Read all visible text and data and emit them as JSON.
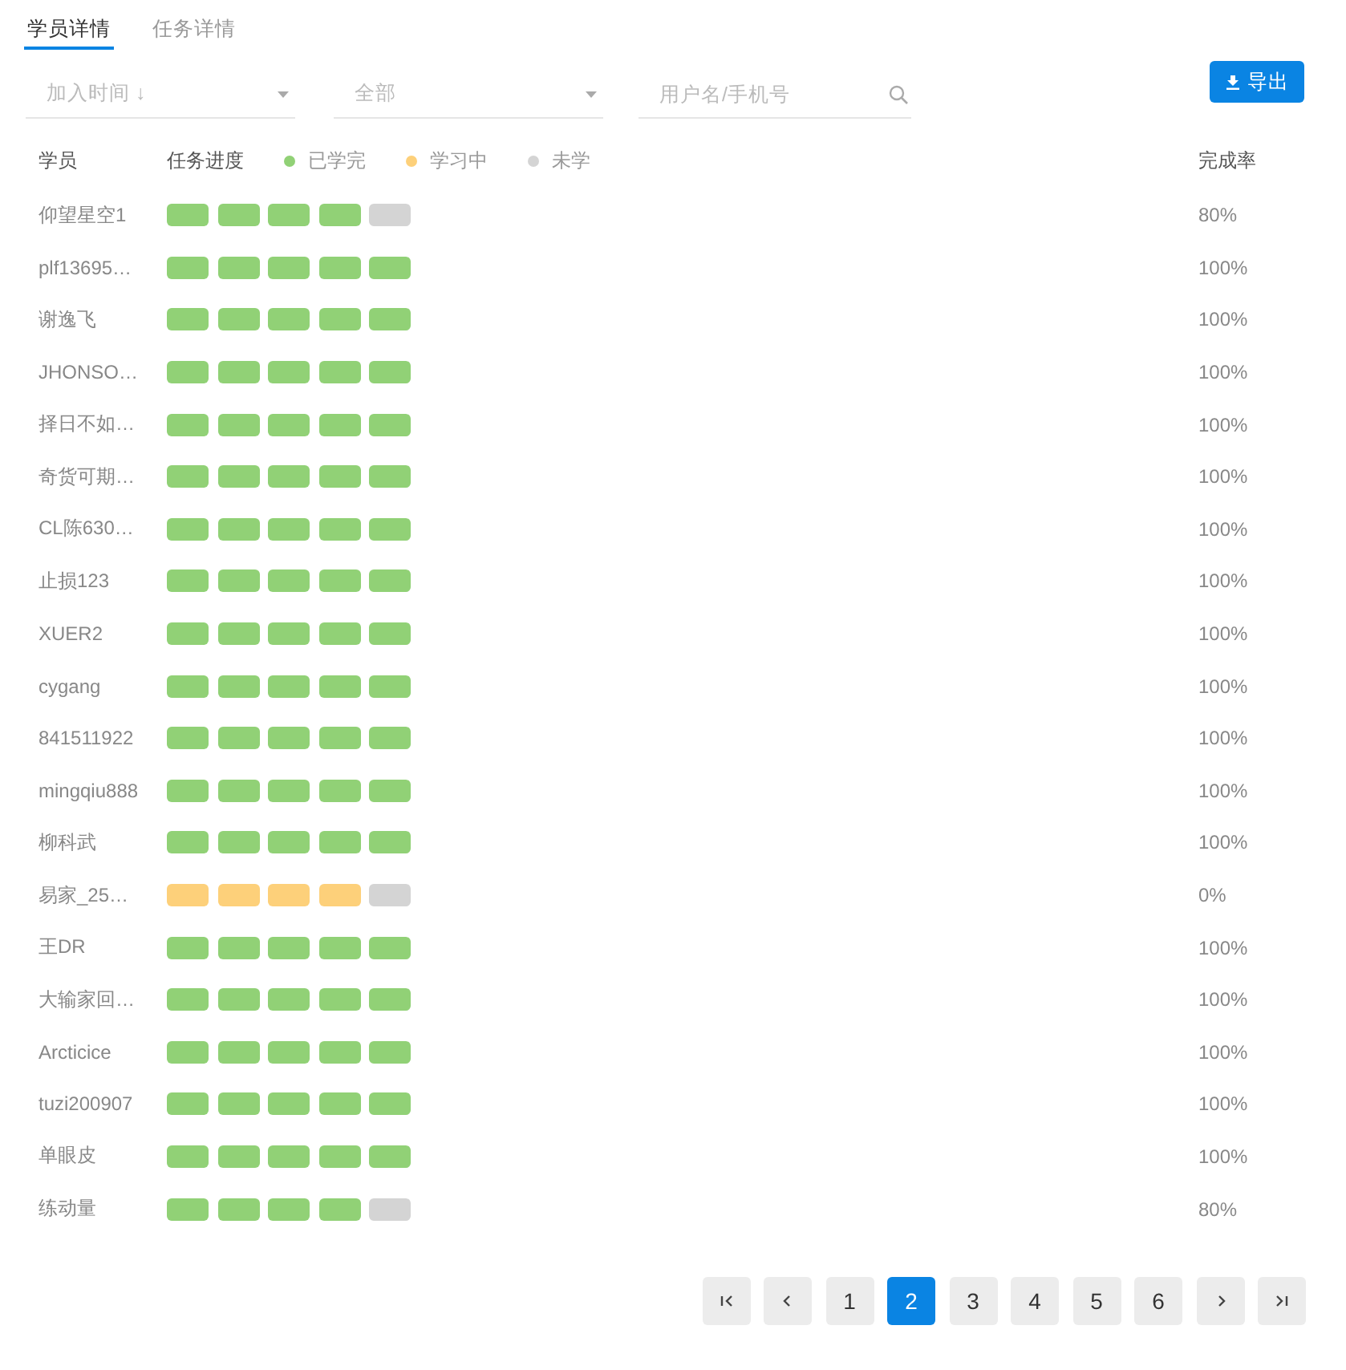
{
  "tabs": [
    {
      "label": "学员详情",
      "selected": true
    },
    {
      "label": "任务详情",
      "selected": false
    }
  ],
  "filters": {
    "sort": {
      "placeholder": "加入时间 ↓"
    },
    "status": {
      "placeholder": "全部"
    },
    "search": {
      "placeholder": "用户名/手机号"
    }
  },
  "export_button": "导出",
  "table": {
    "columns": [
      "学员",
      "任务进度",
      "完成率"
    ],
    "legend": [
      {
        "label": "已学完",
        "color": "#91d176"
      },
      {
        "label": "学习中",
        "color": "#fdd07a"
      },
      {
        "label": "未学",
        "color": "#d4d4d4"
      }
    ],
    "rows": [
      {
        "name": "仰望星空1",
        "segments": [
          {
            "kind": "done"
          },
          {
            "kind": "done"
          },
          {
            "kind": "done"
          },
          {
            "kind": "done"
          },
          {
            "kind": "unstarted"
          }
        ],
        "rate": "80%"
      },
      {
        "name": "plf13695…",
        "segments": [
          {
            "kind": "done"
          },
          {
            "kind": "done"
          },
          {
            "kind": "done"
          },
          {
            "kind": "done"
          },
          {
            "kind": "done"
          }
        ],
        "rate": "100%"
      },
      {
        "name": "谢逸飞",
        "segments": [
          {
            "kind": "done"
          },
          {
            "kind": "done"
          },
          {
            "kind": "done"
          },
          {
            "kind": "done"
          },
          {
            "kind": "done"
          }
        ],
        "rate": "100%"
      },
      {
        "name": "JHONSO…",
        "segments": [
          {
            "kind": "done"
          },
          {
            "kind": "done"
          },
          {
            "kind": "done"
          },
          {
            "kind": "done"
          },
          {
            "kind": "done"
          }
        ],
        "rate": "100%"
      },
      {
        "name": "择日不如…",
        "segments": [
          {
            "kind": "done"
          },
          {
            "kind": "done"
          },
          {
            "kind": "done"
          },
          {
            "kind": "done"
          },
          {
            "kind": "done"
          }
        ],
        "rate": "100%"
      },
      {
        "name": "奇货可期…",
        "segments": [
          {
            "kind": "done"
          },
          {
            "kind": "done"
          },
          {
            "kind": "done"
          },
          {
            "kind": "done"
          },
          {
            "kind": "done"
          }
        ],
        "rate": "100%"
      },
      {
        "name": "CL陈630…",
        "segments": [
          {
            "kind": "done"
          },
          {
            "kind": "done"
          },
          {
            "kind": "done"
          },
          {
            "kind": "done"
          },
          {
            "kind": "done"
          }
        ],
        "rate": "100%"
      },
      {
        "name": "止损123",
        "segments": [
          {
            "kind": "done"
          },
          {
            "kind": "done"
          },
          {
            "kind": "done"
          },
          {
            "kind": "done"
          },
          {
            "kind": "done"
          }
        ],
        "rate": "100%"
      },
      {
        "name": "XUER2",
        "segments": [
          {
            "kind": "done"
          },
          {
            "kind": "done"
          },
          {
            "kind": "done"
          },
          {
            "kind": "done"
          },
          {
            "kind": "done"
          }
        ],
        "rate": "100%"
      },
      {
        "name": "cygang",
        "segments": [
          {
            "kind": "done"
          },
          {
            "kind": "done"
          },
          {
            "kind": "done"
          },
          {
            "kind": "done"
          },
          {
            "kind": "done"
          }
        ],
        "rate": "100%"
      },
      {
        "name": "841511922",
        "segments": [
          {
            "kind": "done"
          },
          {
            "kind": "done"
          },
          {
            "kind": "done"
          },
          {
            "kind": "done"
          },
          {
            "kind": "done"
          }
        ],
        "rate": "100%"
      },
      {
        "name": "mingqiu888",
        "segments": [
          {
            "kind": "done"
          },
          {
            "kind": "done"
          },
          {
            "kind": "done"
          },
          {
            "kind": "done"
          },
          {
            "kind": "done"
          }
        ],
        "rate": "100%"
      },
      {
        "name": "柳科武",
        "segments": [
          {
            "kind": "done"
          },
          {
            "kind": "done"
          },
          {
            "kind": "done"
          },
          {
            "kind": "done"
          },
          {
            "kind": "done"
          }
        ],
        "rate": "100%"
      },
      {
        "name": "易家_25…",
        "segments": [
          {
            "kind": "learning"
          },
          {
            "kind": "learning"
          },
          {
            "kind": "learning"
          },
          {
            "kind": "learning"
          },
          {
            "kind": "unstarted"
          }
        ],
        "rate": "0%"
      },
      {
        "name": "王DR",
        "segments": [
          {
            "kind": "done"
          },
          {
            "kind": "done"
          },
          {
            "kind": "done"
          },
          {
            "kind": "done"
          },
          {
            "kind": "done"
          }
        ],
        "rate": "100%"
      },
      {
        "name": "大输家回…",
        "segments": [
          {
            "kind": "done"
          },
          {
            "kind": "done"
          },
          {
            "kind": "done"
          },
          {
            "kind": "done"
          },
          {
            "kind": "done"
          }
        ],
        "rate": "100%"
      },
      {
        "name": "Arcticice",
        "segments": [
          {
            "kind": "done"
          },
          {
            "kind": "done"
          },
          {
            "kind": "done"
          },
          {
            "kind": "done"
          },
          {
            "kind": "done"
          }
        ],
        "rate": "100%"
      },
      {
        "name": "tuzi200907",
        "segments": [
          {
            "kind": "done"
          },
          {
            "kind": "done"
          },
          {
            "kind": "done"
          },
          {
            "kind": "done"
          },
          {
            "kind": "done"
          }
        ],
        "rate": "100%"
      },
      {
        "name": "单眼皮",
        "segments": [
          {
            "kind": "done"
          },
          {
            "kind": "done"
          },
          {
            "kind": "done"
          },
          {
            "kind": "done"
          },
          {
            "kind": "done"
          }
        ],
        "rate": "100%"
      },
      {
        "name": "练动量",
        "segments": [
          {
            "kind": "done"
          },
          {
            "kind": "done"
          },
          {
            "kind": "done"
          },
          {
            "kind": "done"
          },
          {
            "kind": "unstarted"
          }
        ],
        "rate": "80%"
      }
    ]
  },
  "pagination": {
    "controls": [
      {
        "kind": "first"
      },
      {
        "kind": "prev"
      },
      {
        "kind": "page",
        "label": "1",
        "selected": false
      },
      {
        "kind": "page",
        "label": "2",
        "selected": true
      },
      {
        "kind": "page",
        "label": "3",
        "selected": false
      },
      {
        "kind": "page",
        "label": "4",
        "selected": false
      },
      {
        "kind": "page",
        "label": "5",
        "selected": false
      },
      {
        "kind": "page",
        "label": "6",
        "selected": false
      },
      {
        "kind": "next"
      },
      {
        "kind": "last"
      }
    ]
  }
}
